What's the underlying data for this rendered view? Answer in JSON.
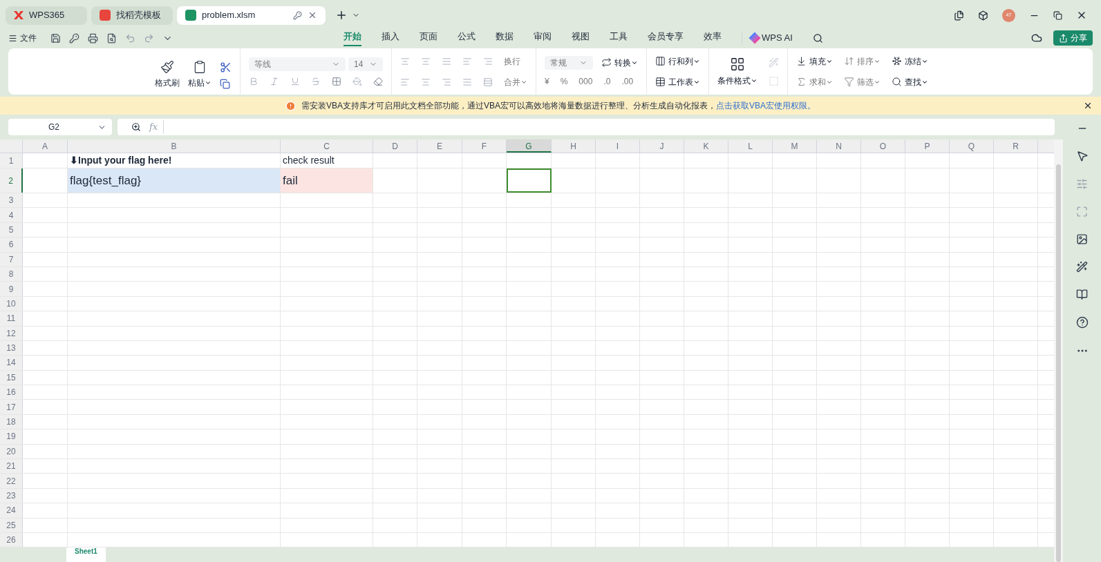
{
  "window_tabs": [
    {
      "label": "WPS365",
      "kind": "home",
      "selected": false
    },
    {
      "label": "找稻壳模板",
      "kind": "template",
      "selected": false
    },
    {
      "label": "problem.xlsm",
      "kind": "sheet",
      "selected": true
    }
  ],
  "account": {
    "badge": "47"
  },
  "menu": {
    "file": "文件",
    "tabs": [
      {
        "label": "开始",
        "selected": true
      },
      {
        "label": "插入",
        "selected": false
      },
      {
        "label": "页面",
        "selected": false
      },
      {
        "label": "公式",
        "selected": false
      },
      {
        "label": "数据",
        "selected": false
      },
      {
        "label": "审阅",
        "selected": false
      },
      {
        "label": "视图",
        "selected": false
      },
      {
        "label": "工具",
        "selected": false
      },
      {
        "label": "会员专享",
        "selected": false
      },
      {
        "label": "效率",
        "selected": false
      }
    ],
    "ai": "WPS AI",
    "share": "分享"
  },
  "ribbon": {
    "font": "等线",
    "size": "14",
    "clipboard": [
      {
        "label": "格式刷",
        "kind": "brush",
        "disabled": false
      },
      {
        "label": "粘贴",
        "kind": "paste",
        "disabled": false
      }
    ],
    "align": [
      {
        "label": "换行",
        "disabled": true
      },
      {
        "label": "合并",
        "disabled": true
      }
    ],
    "number_format": "常规",
    "number_tools": [
      {
        "label": "¥",
        "disabled": true
      },
      {
        "label": "%",
        "disabled": true
      },
      {
        "label": "000",
        "disabled": true
      },
      {
        "label": ".0",
        "disabled": true
      },
      {
        "label": ".00",
        "disabled": true
      }
    ],
    "tools": [
      {
        "label": "转换",
        "kind": "convert",
        "disabled": false
      },
      {
        "label": "行和列",
        "kind": "rows",
        "disabled": false
      },
      {
        "label": "工作表",
        "kind": "sheet",
        "disabled": false
      },
      {
        "label": "条件格式",
        "kind": "conditional",
        "disabled": false
      },
      {
        "label": "填充",
        "kind": "fill",
        "disabled": false
      },
      {
        "label": "求和",
        "kind": "sum",
        "disabled": true
      },
      {
        "label": "排序",
        "kind": "sort",
        "disabled": true
      },
      {
        "label": "筛选",
        "kind": "filter",
        "disabled": true
      },
      {
        "label": "冻结",
        "kind": "freeze",
        "disabled": false
      },
      {
        "label": "查找",
        "kind": "find",
        "disabled": false
      }
    ]
  },
  "banner": {
    "text": "需安装VBA支持库才可启用此文档全部功能，通过VBA宏可以高效地将海量数据进行整理、分析生成自动化报表，",
    "link": "点击获取VBA宏使用权限。"
  },
  "formula_bar": {
    "name_box": "G2",
    "fx": "fx"
  },
  "columns": [
    {
      "label": "A",
      "selected": false
    },
    {
      "label": "B",
      "selected": false
    },
    {
      "label": "C",
      "selected": false
    },
    {
      "label": "D",
      "selected": false
    },
    {
      "label": "E",
      "selected": false
    },
    {
      "label": "F",
      "selected": false
    },
    {
      "label": "G",
      "selected": true
    },
    {
      "label": "H",
      "selected": false
    },
    {
      "label": "I",
      "selected": false
    },
    {
      "label": "J",
      "selected": false
    },
    {
      "label": "K",
      "selected": false
    },
    {
      "label": "L",
      "selected": false
    },
    {
      "label": "M",
      "selected": false
    },
    {
      "label": "N",
      "selected": false
    },
    {
      "label": "O",
      "selected": false
    },
    {
      "label": "P",
      "selected": false
    },
    {
      "label": "Q",
      "selected": false
    },
    {
      "label": "R",
      "selected": false
    }
  ],
  "rows": [
    {
      "header": "1",
      "selected": false,
      "cells": [
        {
          "selected": false
        },
        {
          "text": "⬇Input your flag here!",
          "bold": true,
          "selected": false
        },
        {
          "text": "check result",
          "selected": false
        },
        {
          "selected": false
        },
        {
          "selected": false
        },
        {
          "selected": false
        },
        {
          "selected": false
        }
      ]
    },
    {
      "header": "2",
      "selected": true,
      "cells": [
        {
          "selected": false
        },
        {
          "text": "flag{test_flag}",
          "color": "#dae7f6",
          "selected": false
        },
        {
          "text": "fail",
          "color": "#fbe4e1",
          "selected": false
        },
        {
          "selected": false
        },
        {
          "selected": false
        },
        {
          "selected": false
        },
        {
          "selected": true
        }
      ]
    },
    {
      "header": "3",
      "selected": false
    },
    {
      "header": "4",
      "selected": false
    },
    {
      "header": "5",
      "selected": false
    },
    {
      "header": "6",
      "selected": false
    },
    {
      "header": "7",
      "selected": false
    },
    {
      "header": "8",
      "selected": false
    },
    {
      "header": "9",
      "selected": false
    },
    {
      "header": "10",
      "selected": false
    },
    {
      "header": "11",
      "selected": false
    },
    {
      "header": "12",
      "selected": false
    },
    {
      "header": "13",
      "selected": false
    },
    {
      "header": "14",
      "selected": false
    },
    {
      "header": "15",
      "selected": false
    },
    {
      "header": "16",
      "selected": false
    },
    {
      "header": "17",
      "selected": false
    },
    {
      "header": "18",
      "selected": false
    },
    {
      "header": "19",
      "selected": false
    },
    {
      "header": "20",
      "selected": false
    },
    {
      "header": "21",
      "selected": false
    },
    {
      "header": "22",
      "selected": false
    },
    {
      "header": "23",
      "selected": false
    },
    {
      "header": "24",
      "selected": false
    },
    {
      "header": "25",
      "selected": false
    },
    {
      "header": "26",
      "selected": false
    }
  ],
  "sheet_tabs": [
    {
      "label": "Sheet1",
      "selected": true
    }
  ]
}
